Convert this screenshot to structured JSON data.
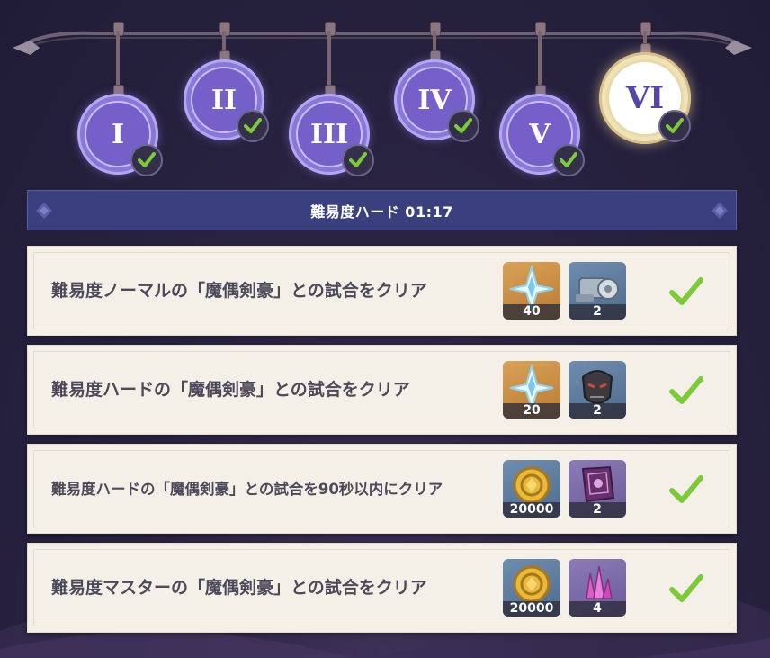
{
  "stages": [
    {
      "numeral": "I",
      "completed": true
    },
    {
      "numeral": "II",
      "completed": true
    },
    {
      "numeral": "III",
      "completed": true
    },
    {
      "numeral": "IV",
      "completed": true
    },
    {
      "numeral": "V",
      "completed": true
    },
    {
      "numeral": "VI",
      "completed": true,
      "selected": true
    }
  ],
  "header": {
    "title": "難易度ハード 01:17"
  },
  "challenges": [
    {
      "description": "難易度ノーマルの「魔偶剣豪」との試合をクリア",
      "rewards": [
        {
          "item": "primogem-icon",
          "quantity": "40"
        },
        {
          "item": "mechanical-part-icon",
          "quantity": "2"
        }
      ],
      "completed": true
    },
    {
      "description": "難易度ハードの「魔偶剣豪」との試合をクリア",
      "rewards": [
        {
          "item": "primogem-icon",
          "quantity": "20"
        },
        {
          "item": "samurai-mask-icon",
          "quantity": "2"
        }
      ],
      "completed": true
    },
    {
      "description": "難易度ハードの「魔偶剣豪」との試合を90秒以内にクリア",
      "rewards": [
        {
          "item": "mora-coin-icon",
          "quantity": "20000"
        },
        {
          "item": "talent-book-icon",
          "quantity": "2"
        }
      ],
      "completed": true
    },
    {
      "description": "難易度マスターの「魔偶剣豪」との試合をクリア",
      "rewards": [
        {
          "item": "mora-coin-icon",
          "quantity": "20000"
        },
        {
          "item": "crystal-icon",
          "quantity": "4"
        }
      ],
      "completed": true
    }
  ],
  "colors": {
    "check": "#7cc93a",
    "header": "#3a3f7e",
    "medal": "#7460c8",
    "selected_medal": "#f0e2b8"
  }
}
